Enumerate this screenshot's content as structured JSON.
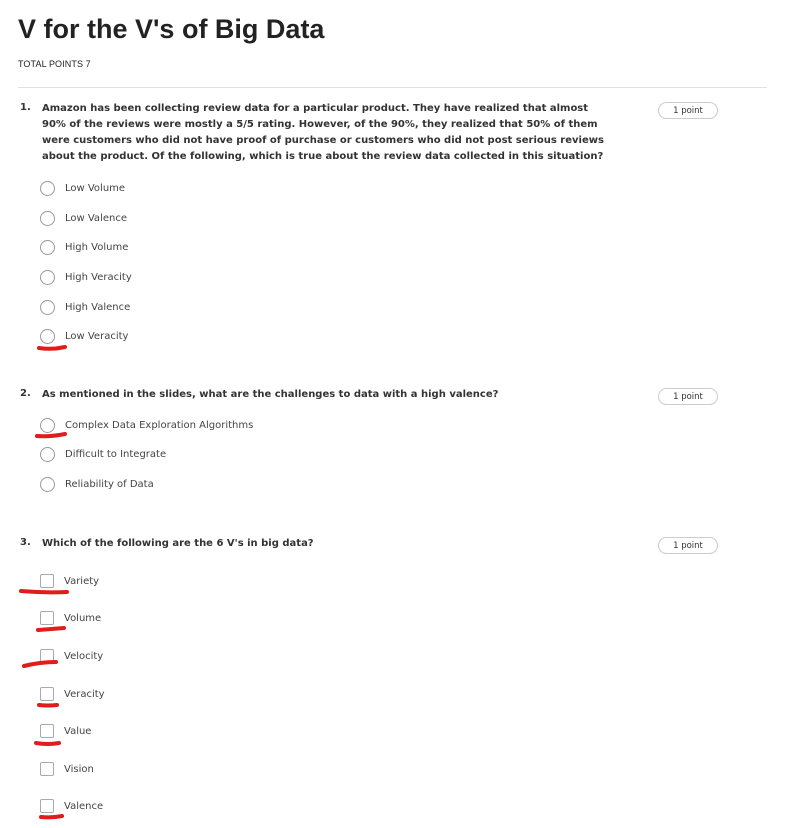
{
  "header": {
    "title": "V for the V's of Big Data",
    "total_points": "TOTAL POINTS 7"
  },
  "questions": [
    {
      "number": "1.",
      "type": "radio",
      "points": "1 point",
      "text": "Amazon has been collecting review data for a particular product. They have realized that almost 90% of the reviews were mostly a 5/5 rating. However, of the 90%, they realized that 50% of them were customers who did not have proof of purchase or customers who did not post serious reviews about the product. Of the following, which is true about the review data collected in this situation?",
      "options": [
        "Low Volume",
        "Low Valence",
        "High Volume",
        "High Veracity",
        "High Valence",
        "Low Veracity"
      ]
    },
    {
      "number": "2.",
      "type": "radio",
      "points": "1 point",
      "text": "As mentioned in the slides, what are the challenges to data with a high valence?",
      "options": [
        "Complex Data Exploration Algorithms",
        "Difficult to Integrate",
        "Reliability of Data"
      ]
    },
    {
      "number": "3.",
      "type": "checkbox",
      "points": "1 point",
      "text": "Which of the following are the 6 V's in big data?",
      "options": [
        "Variety",
        "Volume",
        "Velocity",
        "Veracity",
        "Value",
        "Vision",
        "Valence"
      ]
    }
  ],
  "annotation_color": "#e21b1b"
}
